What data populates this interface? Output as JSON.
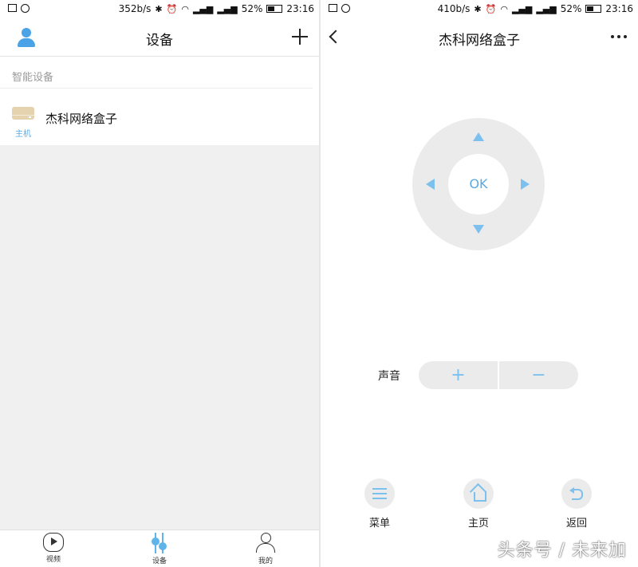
{
  "left_screen": {
    "status": {
      "speed": "352b/s",
      "battery": "52%",
      "time": "23:16"
    },
    "header": {
      "title": "设备"
    },
    "section_label": "智能设备",
    "device": {
      "name": "杰科网络盒子",
      "sub": "主机"
    },
    "nav": {
      "video": "视频",
      "devices": "设备",
      "me": "我的"
    }
  },
  "right_screen": {
    "status": {
      "speed": "410b/s",
      "battery": "52%",
      "time": "23:16"
    },
    "header": {
      "title": "杰科网络盒子"
    },
    "remote": {
      "ok": "OK"
    },
    "volume": {
      "label": "声音",
      "plus": "+",
      "minus": "−"
    },
    "functions": {
      "menu": "菜单",
      "home": "主页",
      "back": "返回"
    }
  },
  "watermark": "头条号 / 未来加",
  "icons": [
    "gallery-icon",
    "message-icon",
    "bluetooth-icon",
    "alarm-icon",
    "wifi-icon",
    "signal-icon",
    "battery-icon",
    "user-icon",
    "plus-icon",
    "back-arrow-icon",
    "more-icon",
    "tv-box-icon",
    "video-icon",
    "device-sliders-icon",
    "person-icon",
    "menu-icon",
    "home-icon",
    "return-icon"
  ],
  "colors": {
    "accent_blue": "#5aa9e0",
    "device_tan": "#e4d3ae",
    "panel_gray": "#ebebeb",
    "empty_gray": "#f0f0f0"
  }
}
